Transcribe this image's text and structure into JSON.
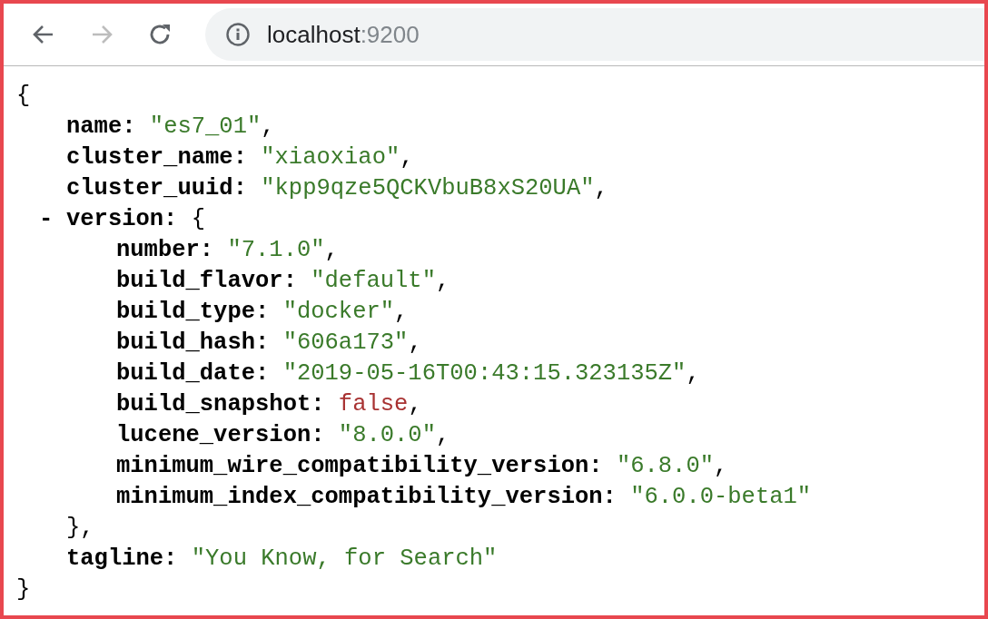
{
  "toolbar": {
    "back": {
      "disabled": false
    },
    "forward": {
      "disabled": true
    },
    "address": {
      "host": "localhost",
      "port": ":9200"
    }
  },
  "json_view": {
    "open": "{",
    "close": "}",
    "members": [
      {
        "key": "name:",
        "value": "\"es7_01\"",
        "kind": "string",
        "comma": ","
      },
      {
        "key": "cluster_name:",
        "value": "\"xiaoxiao\"",
        "kind": "string",
        "comma": ","
      },
      {
        "key": "cluster_uuid:",
        "value": "\"kpp9qze5QCKVbuB8xS20UA\"",
        "kind": "string",
        "comma": ","
      },
      {
        "key": "version:",
        "kind": "object",
        "toggle": "-",
        "expanded": true,
        "open": "{",
        "close": "},",
        "children": [
          {
            "key": "number:",
            "value": "\"7.1.0\"",
            "kind": "string",
            "comma": ","
          },
          {
            "key": "build_flavor:",
            "value": "\"default\"",
            "kind": "string",
            "comma": ","
          },
          {
            "key": "build_type:",
            "value": "\"docker\"",
            "kind": "string",
            "comma": ","
          },
          {
            "key": "build_hash:",
            "value": "\"606a173\"",
            "kind": "string",
            "comma": ","
          },
          {
            "key": "build_date:",
            "value": "\"2019-05-16T00:43:15.323135Z\"",
            "kind": "string",
            "comma": ","
          },
          {
            "key": "build_snapshot:",
            "value": "false",
            "kind": "boolean",
            "comma": ","
          },
          {
            "key": "lucene_version:",
            "value": "\"8.0.0\"",
            "kind": "string",
            "comma": ","
          },
          {
            "key": "minimum_wire_compatibility_version:",
            "value": "\"6.8.0\"",
            "kind": "string",
            "comma": ","
          },
          {
            "key": "minimum_index_compatibility_version:",
            "value": "\"6.0.0-beta1\"",
            "kind": "string"
          }
        ]
      },
      {
        "key": "tagline:",
        "value": "\"You Know, for Search\"",
        "kind": "string"
      }
    ]
  }
}
